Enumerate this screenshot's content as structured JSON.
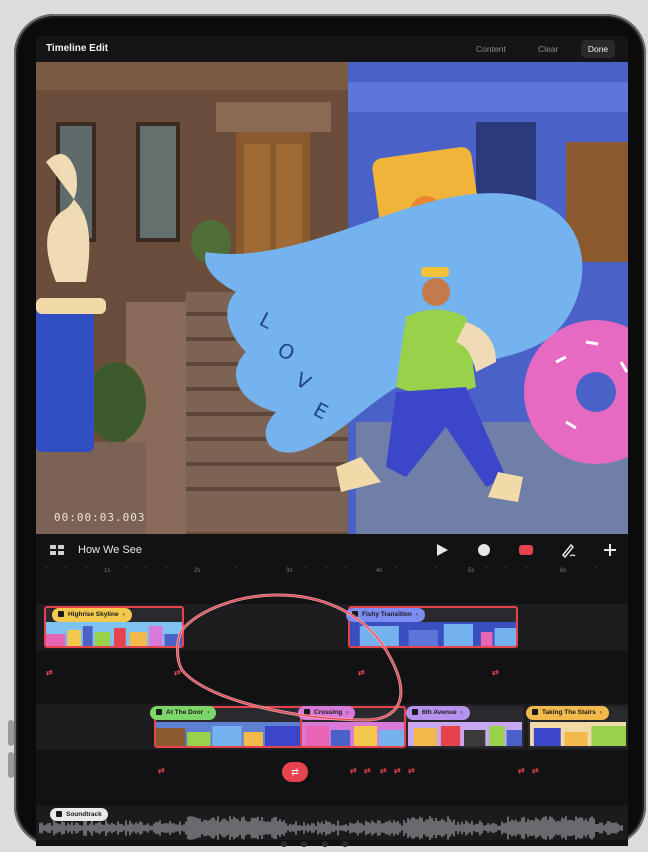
{
  "app": {
    "title": "Timeline Edit",
    "buttons": {
      "content": "Content",
      "clear": "Clear",
      "done": "Done"
    }
  },
  "video": {
    "timecode": "00:00:03.003"
  },
  "toolbar": {
    "project_name": "How We See",
    "icons": [
      "grid-icon",
      "play-icon",
      "record-dot-icon",
      "color-swatch-icon",
      "pen-icon",
      "plus-icon"
    ]
  },
  "ruler": {
    "ticks": [
      "1s",
      "2s",
      "3s",
      "4s",
      "5s",
      "6s"
    ]
  },
  "tracks": {
    "top": [
      {
        "label": "Highrise Skyline",
        "color": "#f2c94c"
      },
      {
        "label": "Fishy Transition",
        "color": "#7d8cf0"
      }
    ],
    "bottom": [
      {
        "label": "At The Door",
        "color": "#7ed66b"
      },
      {
        "label": "Crossing",
        "color": "#d97ad8"
      },
      {
        "label": "6th Avenue",
        "color": "#b592ee"
      },
      {
        "label": "Taking The Stairs",
        "color": "#f2b94c"
      }
    ],
    "audio": {
      "label": "Soundtrack"
    }
  },
  "colors": {
    "accent": "#e7434f",
    "background": "#121214"
  }
}
